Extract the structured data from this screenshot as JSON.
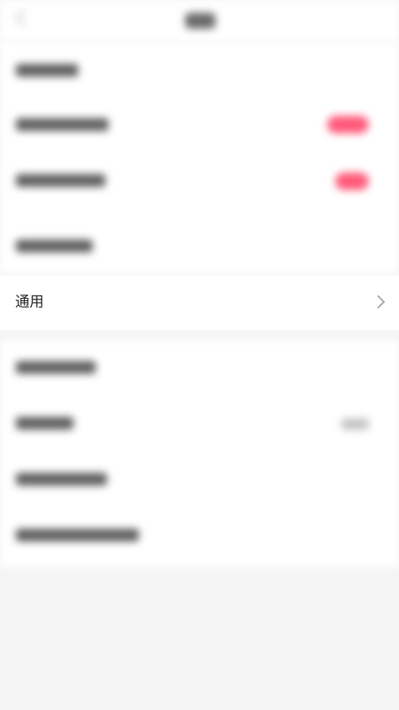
{
  "general_row": {
    "label": "通用"
  },
  "colors": {
    "accent": "#ff5a7a",
    "background": "#f5f5f5",
    "card": "#ffffff",
    "text": "#222222"
  },
  "icons": {
    "back": "chevron-left-icon",
    "row_arrow": "chevron-right-icon"
  }
}
